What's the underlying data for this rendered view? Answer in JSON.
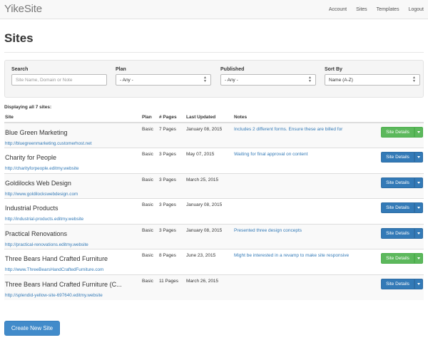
{
  "navbar": {
    "brand": "YikeSite",
    "links": [
      "Account",
      "Sites",
      "Templates",
      "Logout"
    ]
  },
  "page": {
    "title": "Sites"
  },
  "filters": {
    "search": {
      "label": "Search",
      "placeholder": "Site Name, Domain or Note",
      "value": ""
    },
    "plan": {
      "label": "Plan",
      "selected": "- Any -"
    },
    "published": {
      "label": "Published",
      "selected": "- Any -"
    },
    "sort": {
      "label": "Sort By",
      "selected": "Name (A-Z)"
    }
  },
  "table": {
    "count_text": "Displaying all 7 sites:",
    "headers": [
      "Site",
      "Plan",
      "# Pages",
      "Last Updated",
      "Notes"
    ],
    "rows": [
      {
        "name": "Blue Green Marketing",
        "url": "http://bluegreenmarketing.customerhost.net",
        "plan": "Basic",
        "pages": "7 Pages",
        "updated": "January 08, 2015",
        "note": "Includes 2 different forms. Ensure these are billed for",
        "button": "Site Details",
        "button_color": "green"
      },
      {
        "name": "Charity for People",
        "url": "http://charityforpeople.editmy.website",
        "plan": "Basic",
        "pages": "3 Pages",
        "updated": "May 07, 2015",
        "note": "Waiting for final approval on content",
        "button": "Site Details",
        "button_color": "blue"
      },
      {
        "name": "Goldilocks Web Design",
        "url": "http://www.goldilockswebdesign.com",
        "plan": "Basic",
        "pages": "3 Pages",
        "updated": "March 25, 2015",
        "note": "",
        "button": "Site Details",
        "button_color": "blue"
      },
      {
        "name": "Industrial Products",
        "url": "http://industrial-products.editmy.website",
        "plan": "Basic",
        "pages": "3 Pages",
        "updated": "January 08, 2015",
        "note": "",
        "button": "Site Details",
        "button_color": "blue"
      },
      {
        "name": "Practical Renovations",
        "url": "http://practical-renovations.editmy.website",
        "plan": "Basic",
        "pages": "3 Pages",
        "updated": "January 08, 2015",
        "note": "Presented three design concepts",
        "button": "Site Details",
        "button_color": "blue"
      },
      {
        "name": "Three Bears Hand Crafted Furniture",
        "url": "http://www.ThreeBearsHandCraftedFurniture.com",
        "plan": "Basic",
        "pages": "8 Pages",
        "updated": "June 23, 2015",
        "note": "Might be interested in a revamp to make site responsive",
        "button": "Site Details",
        "button_color": "green"
      },
      {
        "name": "Three Bears Hand Crafted Furniture (C...",
        "url": "http://splendid-yellow-site-697640.editmy.website",
        "plan": "Basic",
        "pages": "11 Pages",
        "updated": "March 26, 2015",
        "note": "",
        "button": "Site Details",
        "button_color": "blue"
      }
    ]
  },
  "actions": {
    "create_label": "Create New Site"
  },
  "colors": {
    "primary": "#337ab7",
    "success": "#5cb85c",
    "link": "#337ab7"
  }
}
